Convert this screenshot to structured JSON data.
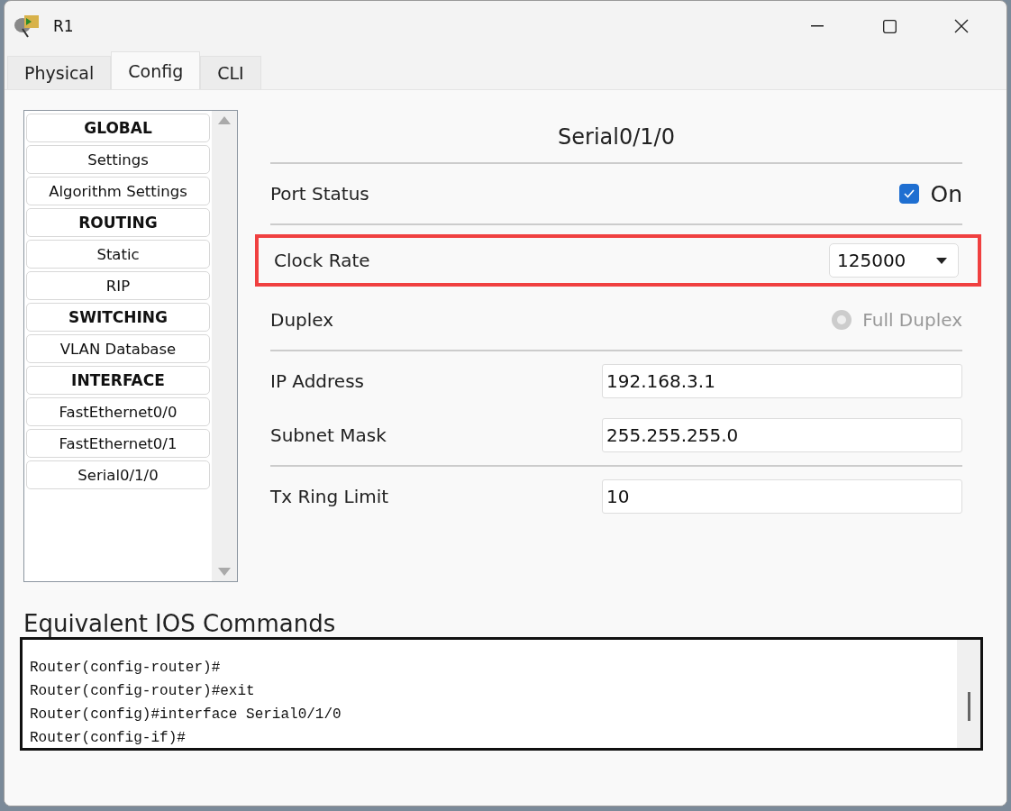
{
  "window": {
    "title": "R1"
  },
  "tabs": [
    {
      "label": "Physical",
      "selected": false
    },
    {
      "label": "Config",
      "selected": true
    },
    {
      "label": "CLI",
      "selected": false
    }
  ],
  "sidebar": {
    "items": [
      {
        "label": "GLOBAL",
        "kind": "header",
        "selected": false
      },
      {
        "label": "Settings",
        "kind": "item",
        "selected": false
      },
      {
        "label": "Algorithm Settings",
        "kind": "item",
        "selected": false
      },
      {
        "label": "ROUTING",
        "kind": "header",
        "selected": false
      },
      {
        "label": "Static",
        "kind": "item",
        "selected": false
      },
      {
        "label": "RIP",
        "kind": "item",
        "selected": false
      },
      {
        "label": "SWITCHING",
        "kind": "header",
        "selected": false
      },
      {
        "label": "VLAN Database",
        "kind": "item",
        "selected": false
      },
      {
        "label": "INTERFACE",
        "kind": "header",
        "selected": false
      },
      {
        "label": "FastEthernet0/0",
        "kind": "item",
        "selected": false
      },
      {
        "label": "FastEthernet0/1",
        "kind": "item",
        "selected": false
      },
      {
        "label": "Serial0/1/0",
        "kind": "item",
        "selected": false
      }
    ]
  },
  "panel": {
    "title": "Serial0/1/0",
    "rows": [
      {
        "kind": "checkbox",
        "label": "Port Status",
        "option": "On",
        "checked": true,
        "divider": true
      },
      {
        "kind": "dropdown",
        "label": "Clock Rate",
        "value": "125000",
        "highlighted": true
      },
      {
        "kind": "radio",
        "label": "Duplex",
        "option": "Full Duplex",
        "checked": false,
        "disabled": true,
        "divider": true
      },
      {
        "kind": "field",
        "label": "IP Address",
        "value": "192.168.3.1"
      },
      {
        "kind": "field",
        "label": "Subnet Mask",
        "value": "255.255.255.0",
        "divider": true
      },
      {
        "kind": "field",
        "label": "Tx Ring Limit",
        "value": "10"
      }
    ]
  },
  "console": {
    "heading": "Equivalent IOS Commands",
    "lines": [
      "Router(config-router)#",
      "Router(config-router)#exit",
      "Router(config)#interface Serial0/1/0",
      "Router(config-if)#"
    ]
  }
}
